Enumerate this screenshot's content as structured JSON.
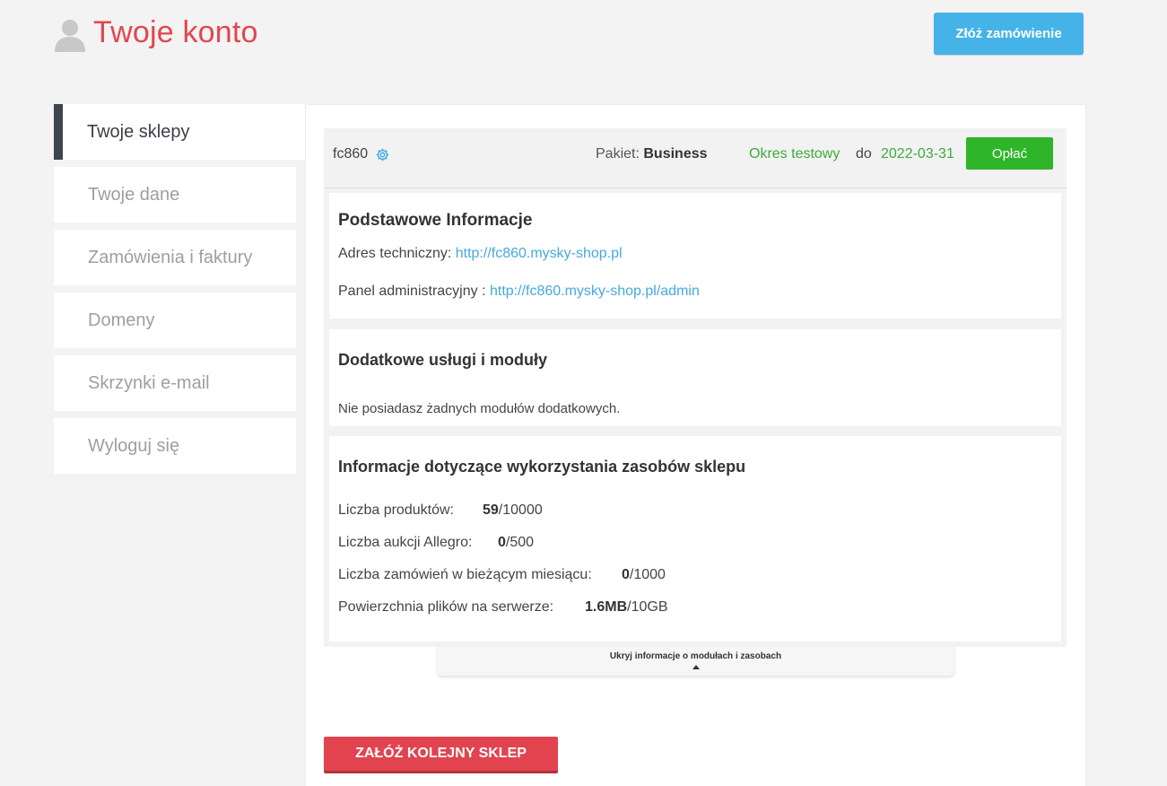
{
  "header": {
    "title": "Twoje konto",
    "order_button": "Złóż zamówienie",
    "title_color": "#e0474f",
    "order_button_color": "#45b3e7"
  },
  "sidebar": {
    "items": [
      {
        "label": "Twoje sklepy",
        "active": true
      },
      {
        "label": "Twoje dane",
        "active": false
      },
      {
        "label": "Zamówienia i faktury",
        "active": false
      },
      {
        "label": "Domeny",
        "active": false
      },
      {
        "label": "Skrzynki e-mail",
        "active": false
      },
      {
        "label": "Wyloguj się",
        "active": false
      }
    ]
  },
  "shop": {
    "name": "fc860",
    "package_label": "Pakiet:",
    "package_value": "Business",
    "trial_label": "Okres testowy",
    "until_label": "do",
    "until_date": "2022-03-31",
    "pay_button": "Opłać",
    "pay_button_color": "#2fb52a",
    "basic_info": {
      "title": "Podstawowe Informacje",
      "tech_address_label": "Adres techniczny:",
      "tech_address_url": "http://fc860.mysky-shop.pl",
      "admin_panel_label": "Panel administracyjny :",
      "admin_panel_url": "http://fc860.mysky-shop.pl/admin"
    },
    "additional": {
      "title": "Dodatkowe usługi i moduły",
      "empty_text": "Nie posiadasz żadnych modułów dodatkowych."
    },
    "resources": {
      "title": "Informacje dotyczące wykorzystania zasobów sklepu",
      "rows": [
        {
          "label": "Liczba produktów:",
          "used": "59",
          "limit": "/10000"
        },
        {
          "label": "Liczba aukcji Allegro:",
          "used": "0",
          "limit": "/500"
        },
        {
          "label": "Liczba zamówień w bieżącym miesiącu:",
          "used": "0",
          "limit": "/1000"
        },
        {
          "label": "Powierzchnia plików na serwerze:",
          "used": "1.6MB",
          "limit": "/10GB"
        }
      ]
    },
    "toggle_label": "Ukryj informacje o modułach i zasobach"
  },
  "new_shop_button": "ZAŁÓŻ KOLEJNY SKLEP",
  "new_shop_button_color": "#e1434f"
}
